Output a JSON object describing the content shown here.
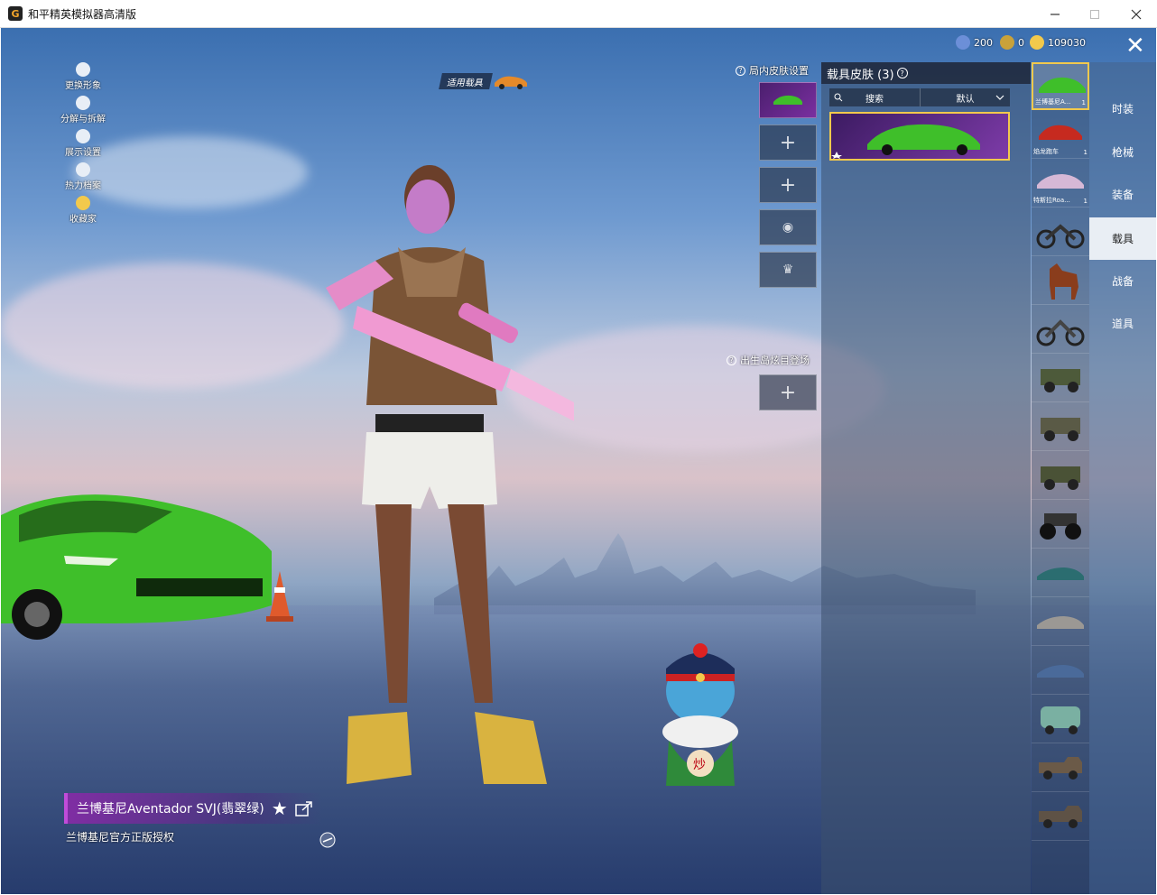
{
  "window": {
    "title": "和平精英模拟器高清版",
    "minimize_icon": "minimize-icon",
    "maximize_icon": "maximize-icon",
    "close_icon": "close-icon"
  },
  "currencies": [
    {
      "name": "gem-coin-icon",
      "value": "200"
    },
    {
      "name": "badge-coin-icon",
      "value": "0"
    },
    {
      "name": "gold-coin-icon",
      "value": "109030"
    }
  ],
  "left_menu": [
    {
      "icon": "person-icon",
      "label": "更换形象"
    },
    {
      "icon": "puzzle-icon",
      "label": "分解与拆解"
    },
    {
      "icon": "eye-icon",
      "label": "展示设置"
    },
    {
      "icon": "flame-icon",
      "label": "热力档案"
    },
    {
      "icon": "trophy-icon",
      "label": "收藏家"
    }
  ],
  "apply_vehicle_label": "适用载具",
  "in_game_skin_label": "局内皮肤设置",
  "spawn_island_label": "出生岛炫目登场",
  "skin_panel": {
    "title": "载具皮肤 (3)",
    "search_label": "搜索",
    "sort_label": "默认"
  },
  "vehicles": [
    {
      "label": "兰博基尼A...",
      "count": "1"
    },
    {
      "label": "焰龙跑车",
      "count": "1"
    },
    {
      "label": "特斯拉Roa...",
      "count": "1"
    },
    {
      "label": "",
      "count": ""
    },
    {
      "label": "",
      "count": ""
    },
    {
      "label": "",
      "count": ""
    },
    {
      "label": "",
      "count": ""
    },
    {
      "label": "",
      "count": ""
    },
    {
      "label": "",
      "count": ""
    },
    {
      "label": "",
      "count": ""
    },
    {
      "label": "",
      "count": ""
    },
    {
      "label": "",
      "count": ""
    },
    {
      "label": "",
      "count": ""
    },
    {
      "label": "",
      "count": ""
    },
    {
      "label": "",
      "count": ""
    },
    {
      "label": "",
      "count": ""
    }
  ],
  "categories": [
    "时装",
    "枪械",
    "装备",
    "载具",
    "战备",
    "道具"
  ],
  "active_category": "载具",
  "item_name": "兰博基尼Aventador SVJ(翡翠绿)",
  "item_license": "兰博基尼官方正版授权",
  "colors": {
    "accent_gold": "#f2c94c",
    "rarity_purple": "#7d3ba8",
    "car_green": "#3fbf2a"
  }
}
